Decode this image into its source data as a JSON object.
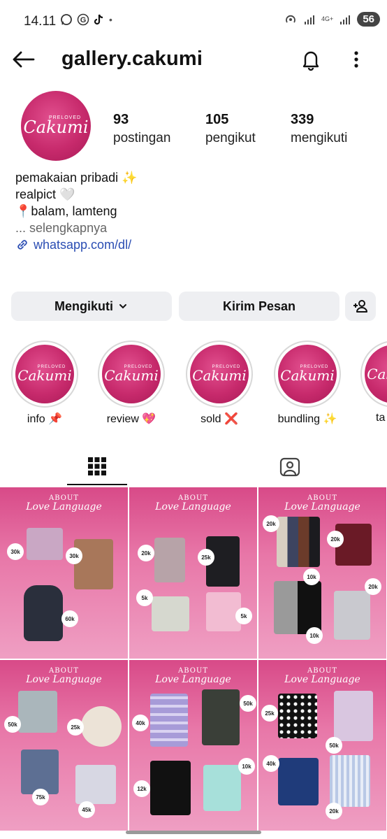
{
  "status_bar": {
    "time": "14.11",
    "network": "4G+",
    "battery": "56"
  },
  "header": {
    "username": "gallery.cakumi"
  },
  "profile": {
    "logo_small": "PRELOVED",
    "logo_text": "Cakumi",
    "stats": [
      {
        "value": "93",
        "label": "postingan"
      },
      {
        "value": "105",
        "label": "pengikut"
      },
      {
        "value": "339",
        "label": "mengikuti"
      }
    ],
    "bio": {
      "line1": "pemakaian pribadi ✨",
      "line2": "realpict 🤍",
      "line3": "📍balam, lamteng",
      "more": "... selengkapnya",
      "link": "whatsapp.com/dl/"
    }
  },
  "actions": {
    "follow_label": "Mengikuti",
    "message_label": "Kirim Pesan"
  },
  "highlights": [
    {
      "label": "info 📌"
    },
    {
      "label": "review 💖"
    },
    {
      "label": "sold ❌"
    },
    {
      "label": "bundling ✨"
    },
    {
      "label": "ta"
    }
  ],
  "posts": {
    "title_top": "ABOUT",
    "title_bottom": "Love Language",
    "prices": [
      [
        "30k",
        "30k",
        "60k"
      ],
      [
        "20k",
        "25k",
        "5k",
        "5k"
      ],
      [
        "20k",
        "20k",
        "10k",
        "20k",
        "10k"
      ],
      [
        "50k",
        "25k",
        "75k",
        "45k"
      ],
      [
        "40k",
        "50k",
        "12k",
        "10k"
      ],
      [
        "25k",
        "50k",
        "40k",
        "20k"
      ]
    ]
  }
}
